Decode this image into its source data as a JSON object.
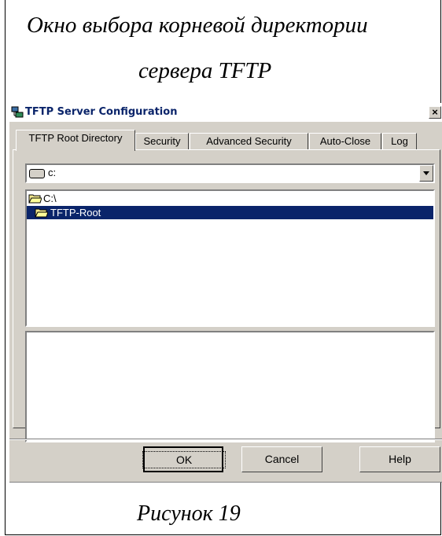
{
  "captions": {
    "line1": "Окно выбора корневой директории",
    "line2": "сервера TFTP",
    "figure": "Рисунок 19"
  },
  "window": {
    "title": "TFTP Server Configuration",
    "close_label": "×"
  },
  "tabs": [
    {
      "label": "TFTP Root Directory",
      "active": true
    },
    {
      "label": "Security",
      "active": false
    },
    {
      "label": "Advanced Security",
      "active": false
    },
    {
      "label": "Auto-Close",
      "active": false
    },
    {
      "label": "Log",
      "active": false
    }
  ],
  "drive_select": {
    "value": "c:",
    "icon": "drive-icon"
  },
  "folder_tree": [
    {
      "label": "C:\\",
      "selected": false,
      "icon": "open-folder-icon"
    },
    {
      "label": "TFTP-Root",
      "selected": true,
      "icon": "open-folder-icon"
    }
  ],
  "buttons": {
    "ok": "OK",
    "cancel": "Cancel",
    "help": "Help"
  },
  "colors": {
    "selection": "#0a246a",
    "dialog_bg": "#d4d0c8"
  }
}
